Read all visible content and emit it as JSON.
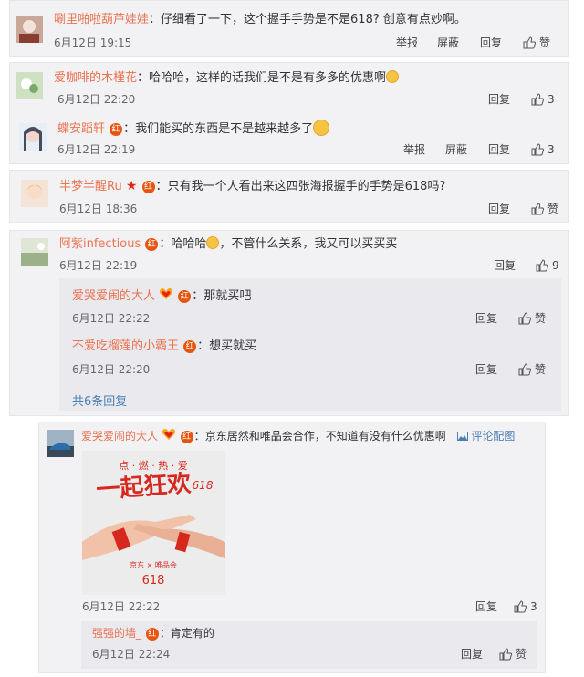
{
  "comments": [
    {
      "user": "唰里啪啦葫芦娃娃",
      "text": "仔细看了一下，这个握手手势是不是618? 创意有点妙啊。",
      "time": "6月12日 19:15",
      "report": "举报",
      "block": "屏蔽",
      "reply": "回复",
      "like": "赞"
    },
    {
      "user": "爱咖啡的木槿花",
      "text": "哈哈哈，这样的话我们是不是有多多的优惠啊",
      "time": "6月12日 22:20",
      "reply": "回复",
      "likes": "3"
    },
    {
      "user": "蝶安蹈轩",
      "badge": "红",
      "text": "我们能买的东西是不是越来越多了",
      "time": "6月12日 22:19",
      "report": "举报",
      "block": "屏蔽",
      "reply": "回复",
      "likes": "3"
    },
    {
      "user": "半梦半醒Ru",
      "badge": "红",
      "text": "只有我一个人看出来这四张海报握手的手势是618吗?",
      "time": "6月12日 18:36",
      "reply": "回复",
      "like": "赞"
    },
    {
      "user": "阿紫infectious",
      "badge": "红",
      "text": "哈哈哈",
      "text2": "，不管什么关系，我又可以买买买",
      "time": "6月12日 22:19",
      "reply": "回复",
      "likes": "9",
      "replies": [
        {
          "user": "爱哭爱闹的大人",
          "badge": "红",
          "text": "那就买吧",
          "time": "6月12日 22:22",
          "reply": "回复",
          "like": "赞"
        },
        {
          "user": "不爱吃榴莲的小霸王",
          "badge": "红",
          "text": "想买就买",
          "time": "6月12日 22:20",
          "reply": "回复",
          "like": "赞"
        }
      ],
      "more": "共6条回复"
    },
    {
      "user": "爱哭爱闹的大人",
      "badge": "红",
      "text": "京东居然和唯品会合作，不知道有没有什么优惠啊",
      "pic_link": "评论配图",
      "time": "6月12日 22:22",
      "reply": "回复",
      "likes": "3",
      "poster": {
        "top": "点 · 燃 · 热 · 爱",
        "title": "一起狂欢",
        "title_num": "618",
        "brands": "京东 × 唯品会",
        "bottom_num": "618"
      },
      "replies": [
        {
          "user": "强强的墙_",
          "badge": "红",
          "text": "肯定有的",
          "time": "6月12日 22:24",
          "reply": "回复",
          "like": "赞"
        }
      ]
    }
  ],
  "colors": {
    "name": "#eb7350",
    "badge": "#e8540d",
    "link": "#4a7fb5",
    "card": "#f2f2f5"
  }
}
